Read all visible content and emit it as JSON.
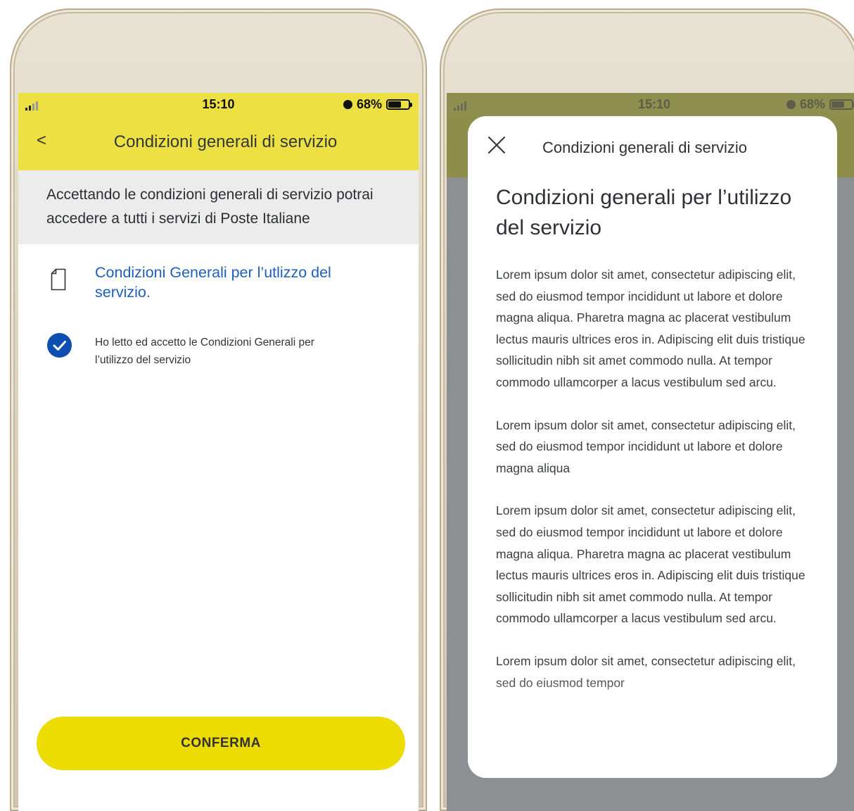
{
  "left": {
    "status": {
      "time": "15:10",
      "battery": "68%",
      "battery_level": 0.68
    },
    "header": {
      "back": "<",
      "title": "Condizioni generali di servizio"
    },
    "intro": "Accettando le condizioni generali di servizio potrai accedere a tutti i servizi di Poste Italiane",
    "document_link": "Condizioni Generali per l’utlizzo del servizio.",
    "checkbox": {
      "checked": true,
      "label": "Ho letto ed accetto le Condizioni Generali per l’utilizzo del servizio"
    },
    "confirm_label": "CONFERMA"
  },
  "right": {
    "status": {
      "time": "15:10",
      "battery": "68%",
      "battery_level": 0.68
    },
    "modal": {
      "header_title": "Condizioni generali di servizio",
      "heading": "Condizioni generali per l’utilizzo del servizio",
      "paragraphs": [
        "Lorem ipsum dolor sit amet, consectetur adipiscing elit, sed do eiusmod tempor incididunt ut labore et dolore magna aliqua. Pharetra magna ac placerat vestibulum lectus mauris ultrices eros in. Adipiscing elit duis tristique sollicitudin nibh sit amet commodo nulla. At tempor commodo ullamcorper a lacus vestibulum sed arcu.",
        "Lorem ipsum dolor sit amet, consectetur adipiscing elit, sed do eiusmod tempor incididunt ut labore et dolore magna aliqua",
        "Lorem ipsum dolor sit amet, consectetur adipiscing elit, sed do eiusmod tempor incididunt ut labore et dolore magna aliqua. Pharetra magna ac placerat vestibulum lectus mauris ultrices eros in. Adipiscing elit duis tristique sollicitudin nibh sit amet commodo nulla. At tempor commodo ullamcorper a lacus vestibulum sed arcu.",
        "Lorem ipsum dolor sit amet, consectetur adipiscing elit, sed do eiusmod tempor"
      ]
    }
  },
  "colors": {
    "accent_yellow": "#ecdc00",
    "header_yellow": "#ece043",
    "link_blue": "#1d5fbf",
    "check_blue": "#0d4fb0"
  }
}
